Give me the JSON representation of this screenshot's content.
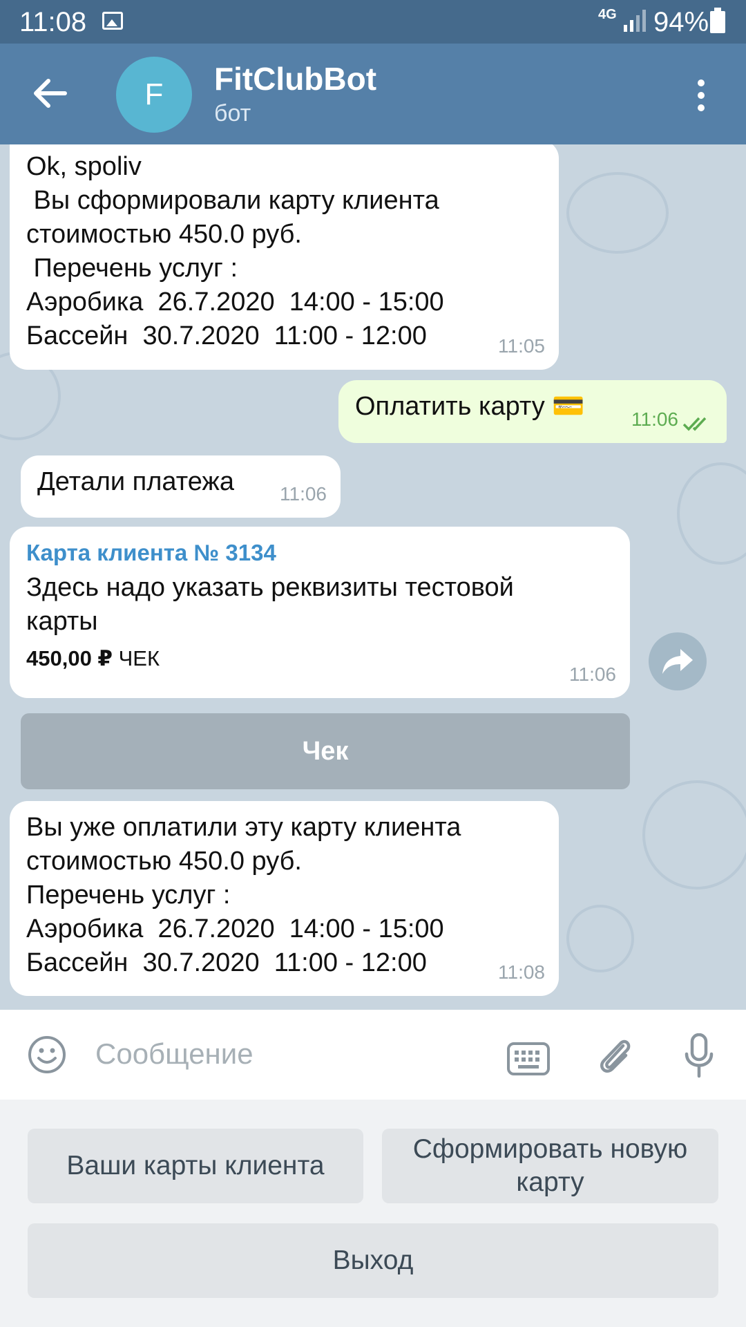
{
  "status_bar": {
    "time": "11:08",
    "network": "4G",
    "battery": "94%"
  },
  "header": {
    "avatar_letter": "F",
    "title": "FitClubBot",
    "subtitle": "бот"
  },
  "messages": [
    {
      "text": "Ok, spoliv\n Вы сформировали карту клиента\nстоимостью 450.0 руб.\n Перечень услуг :\nАэробика  26.7.2020  14:00 - 15:00\nБассейн  30.7.2020  11:00 - 12:00",
      "time": "11:05"
    },
    {
      "text": "Оплатить карту",
      "emoji": "💳",
      "time": "11:06"
    },
    {
      "text": "Детали платежа",
      "time": "11:06"
    },
    {
      "invoice_title": "Карта клиента № 3134",
      "text": "Здесь надо указать реквизиты тестовой\nкарты",
      "amount": "450,00 ₽",
      "amount_label": "ЧЕК",
      "time": "11:06"
    },
    {
      "text": "Вы уже оплатили эту карту клиента\nстоимостью 450.0 руб.\nПеречень услуг :\nАэробика  26.7.2020  14:00 - 15:00\nБассейн  30.7.2020  11:00 - 12:00",
      "time": "11:08"
    }
  ],
  "inline_button": "Чек",
  "composer": {
    "placeholder": "Сообщение"
  },
  "reply_keyboard": {
    "b1": "Ваши карты клиента",
    "b2": "Сформировать новую карту",
    "b3": "Выход"
  },
  "colors": {
    "header": "#5580a8",
    "status": "#456a8c",
    "avatar": "#58b6d2",
    "outgoing": "#effedd",
    "link": "#3e8fcb"
  }
}
